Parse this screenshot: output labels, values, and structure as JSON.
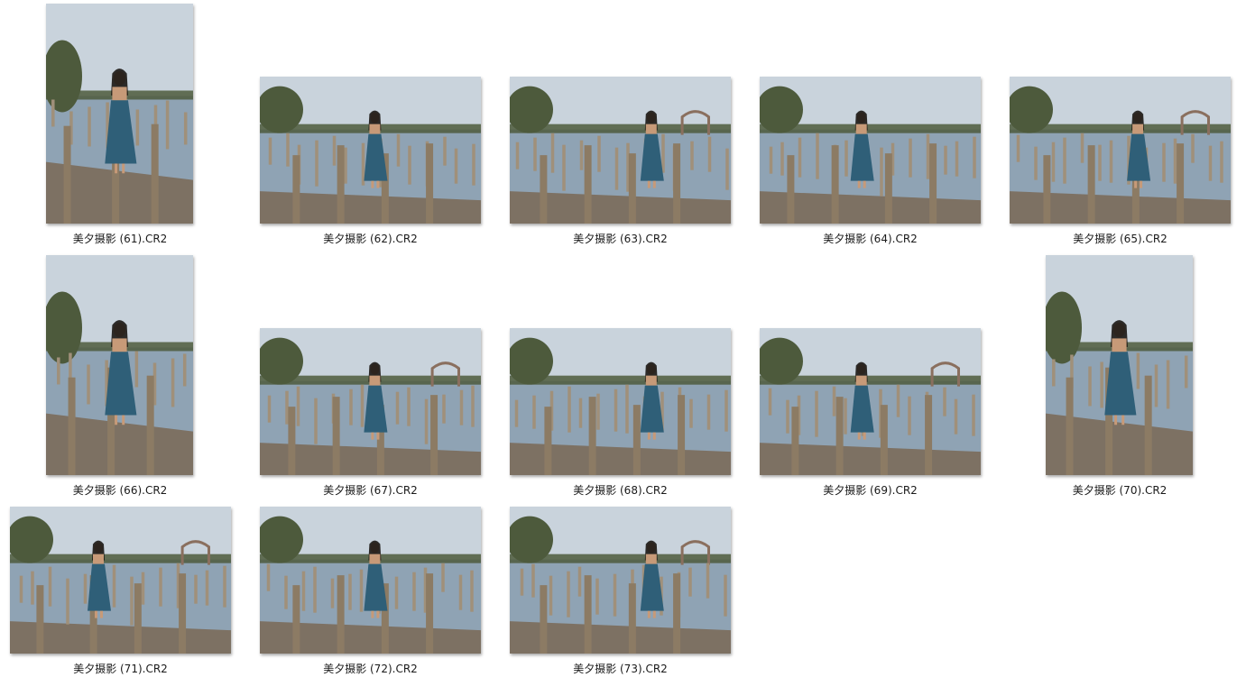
{
  "gallery": {
    "items": [
      {
        "name": "美夕摄影 (61).CR2",
        "orientation": "portrait",
        "thumbnail": "photo-thumbnail"
      },
      {
        "name": "美夕摄影 (62).CR2",
        "orientation": "landscape",
        "thumbnail": "photo-thumbnail"
      },
      {
        "name": "美夕摄影 (63).CR2",
        "orientation": "landscape",
        "thumbnail": "photo-thumbnail"
      },
      {
        "name": "美夕摄影 (64).CR2",
        "orientation": "landscape",
        "thumbnail": "photo-thumbnail"
      },
      {
        "name": "美夕摄影 (65).CR2",
        "orientation": "landscape",
        "thumbnail": "photo-thumbnail"
      },
      {
        "name": "美夕摄影 (66).CR2",
        "orientation": "portrait",
        "thumbnail": "photo-thumbnail"
      },
      {
        "name": "美夕摄影 (67).CR2",
        "orientation": "landscape",
        "thumbnail": "photo-thumbnail"
      },
      {
        "name": "美夕摄影 (68).CR2",
        "orientation": "landscape",
        "thumbnail": "photo-thumbnail"
      },
      {
        "name": "美夕摄影 (69).CR2",
        "orientation": "landscape",
        "thumbnail": "photo-thumbnail"
      },
      {
        "name": "美夕摄影 (70).CR2",
        "orientation": "portrait",
        "thumbnail": "photo-thumbnail"
      },
      {
        "name": "美夕摄影 (71).CR2",
        "orientation": "landscape",
        "thumbnail": "photo-thumbnail"
      },
      {
        "name": "美夕摄影 (72).CR2",
        "orientation": "landscape",
        "thumbnail": "photo-thumbnail"
      },
      {
        "name": "美夕摄影 (73).CR2",
        "orientation": "landscape",
        "thumbnail": "photo-thumbnail"
      }
    ],
    "colors": {
      "sky": "#c9d3dc",
      "water": "#8fa3b4",
      "post": "#a0907a",
      "boardwalk": "#7d7163",
      "foliage": "#4d5a3c",
      "dress": "#2f5f78",
      "skin": "#c79a78",
      "hair": "#1b1714"
    }
  }
}
